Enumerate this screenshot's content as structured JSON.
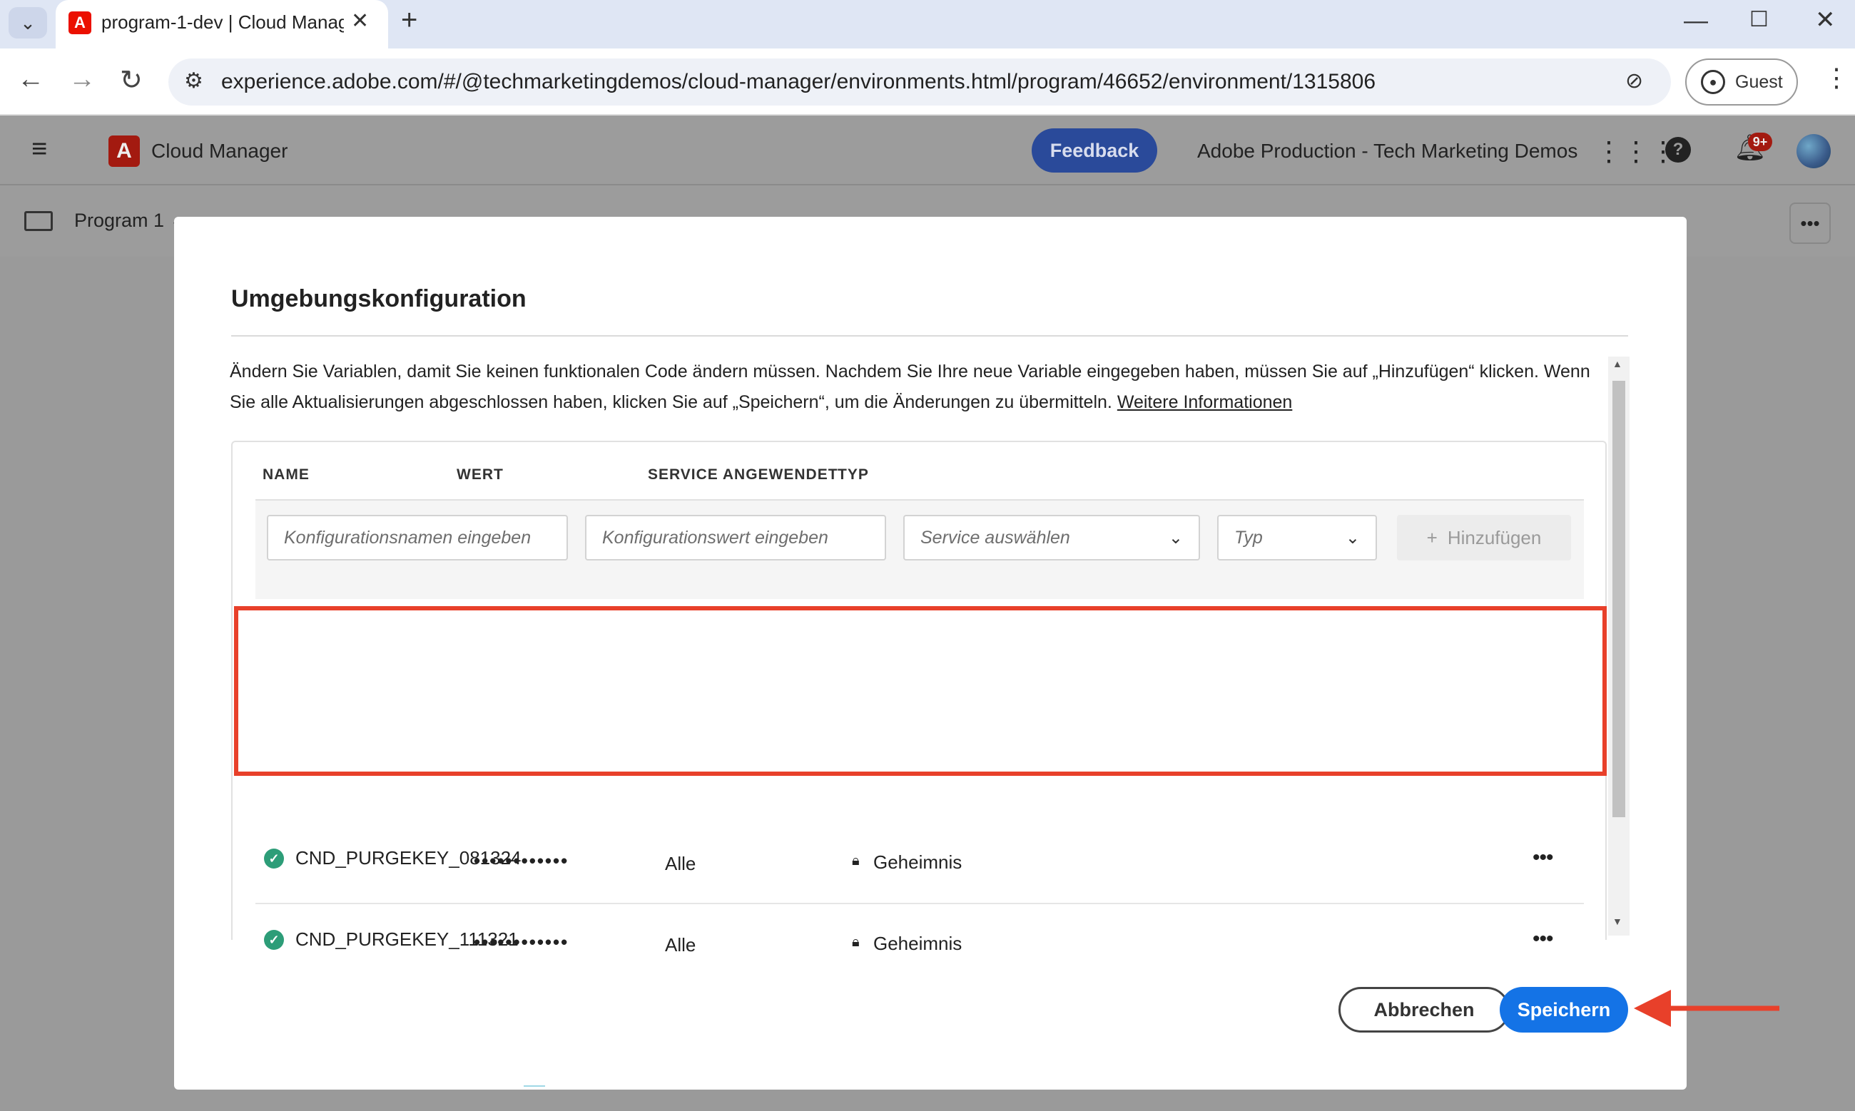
{
  "browser": {
    "tab_title": "program-1-dev | Cloud Manage",
    "url": "experience.adobe.com/#/@techmarketingdemos/cloud-manager/environments.html/program/46652/environment/1315806",
    "profile_label": "Guest"
  },
  "app": {
    "name": "Cloud Manager",
    "feedback_label": "Feedback",
    "org_name": "Adobe Production - Tech Marketing Demos",
    "notification_count": "9+",
    "program_label": "Program 1"
  },
  "dialog": {
    "title": "Umgebungskonfiguration",
    "description": "Ändern Sie Variablen, damit Sie keinen funktionalen Code ändern müssen. Nachdem Sie Ihre neue Variable eingegeben haben, müssen Sie auf „Hinzufügen“ klicken. Wenn Sie alle Aktualisierungen abgeschlossen haben, klicken Sie auf „Speichern“, um die Änderungen zu übermitteln.",
    "learn_more": "Weitere Informationen",
    "columns": {
      "name": "NAME",
      "value": "WERT",
      "service": "SERVICE ANGEWENDET",
      "type": "TYP"
    },
    "inputs": {
      "name_placeholder": "Konfigurationsnamen eingeben",
      "value_placeholder": "Konfigurationswert eingeben",
      "service_placeholder": "Service auswählen",
      "type_placeholder": "Typ",
      "add_label": "Hinzufügen"
    },
    "rows": [
      {
        "name": "CND_PURGEKEY_081324",
        "value": "••••••••••••",
        "service": "Alle",
        "type": "Geheimnis"
      },
      {
        "name": "CND_PURGEKEY_111321",
        "value": "••••••••••••",
        "service": "Alle",
        "type": "Geheimnis"
      }
    ],
    "cancel_label": "Abbrechen",
    "save_label": "Speichern"
  },
  "colors": {
    "accent": "#1473e6",
    "highlight": "#e8402a",
    "success": "#2d9d78"
  }
}
